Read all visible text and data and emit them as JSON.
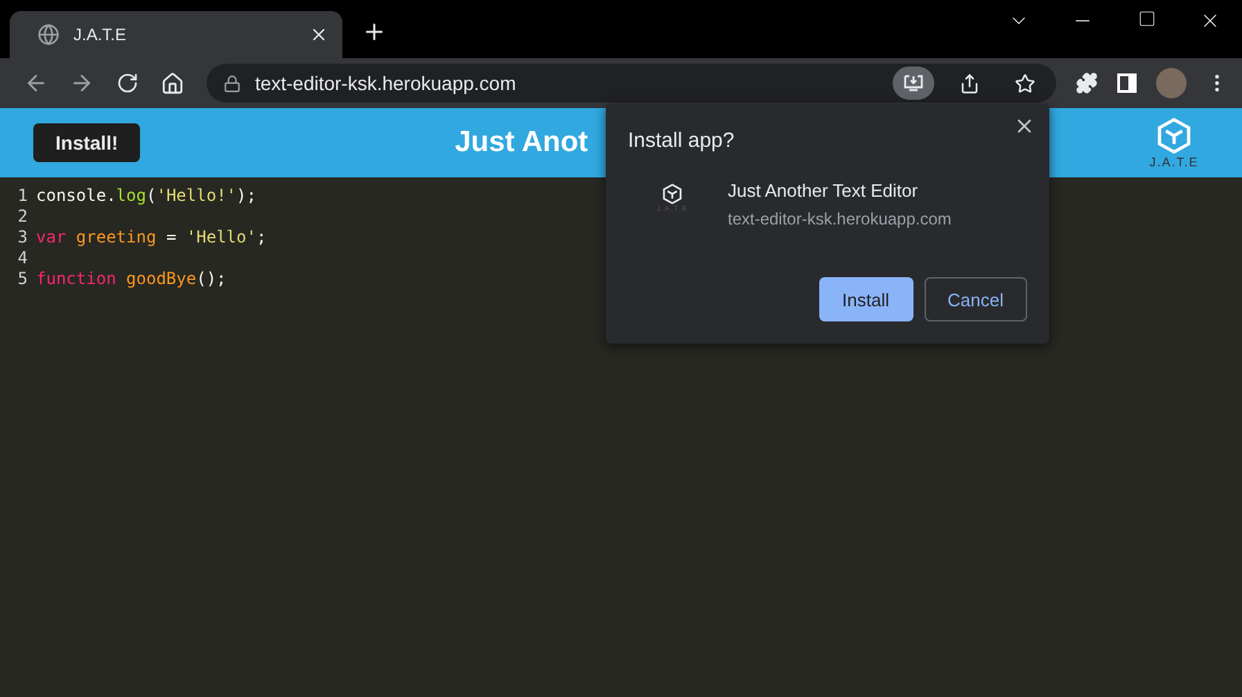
{
  "window": {
    "tab": {
      "title": "J.A.T.E",
      "selected": true
    }
  },
  "toolbar": {
    "url": "text-editor-ksk.herokuapp.com"
  },
  "header": {
    "install_button": "Install!",
    "title": "Just Anot",
    "logo_text": "J.A.T.E"
  },
  "editor": {
    "lines": [
      {
        "number": "1",
        "tokens": [
          {
            "text": "console.",
            "kind": "plain"
          },
          {
            "text": "log",
            "kind": "func"
          },
          {
            "text": "(",
            "kind": "plain"
          },
          {
            "text": "'Hello!'",
            "kind": "string"
          },
          {
            "text": ");",
            "kind": "plain"
          }
        ]
      },
      {
        "number": "2"
      },
      {
        "number": "3",
        "tokens": [
          {
            "text": "var",
            "kind": "keyword"
          },
          {
            "text": " greeting",
            "kind": "variable"
          },
          {
            "text": " = ",
            "kind": "plain"
          },
          {
            "text": "'Hello'",
            "kind": "string"
          },
          {
            "text": ";",
            "kind": "plain"
          }
        ]
      },
      {
        "number": "4"
      },
      {
        "number": "5",
        "tokens": [
          {
            "text": "function",
            "kind": "keyword"
          },
          {
            "text": " goodBye",
            "kind": "variable"
          },
          {
            "text": "();",
            "kind": "plain"
          }
        ]
      }
    ]
  },
  "install_dialog": {
    "title": "Install app?",
    "app_icon_label": "J.A.T.E",
    "app_name": "Just Another Text Editor",
    "app_url": "text-editor-ksk.herokuapp.com",
    "buttons": [
      {
        "label": "Install",
        "kind": "primary"
      },
      {
        "label": "Cancel",
        "kind": "secondary"
      }
    ]
  }
}
